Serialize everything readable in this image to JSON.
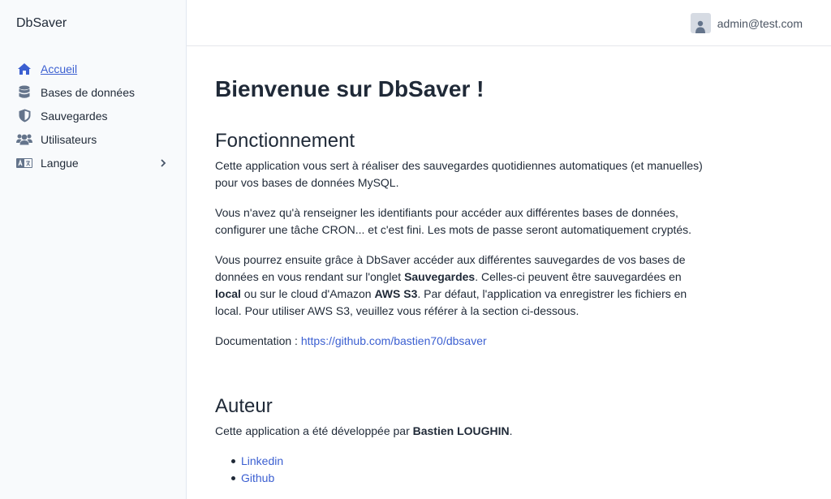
{
  "sidebar": {
    "brand": "DbSaver",
    "items": [
      {
        "label": "Accueil",
        "icon": "home-icon",
        "active": true
      },
      {
        "label": "Bases de données",
        "icon": "database-icon"
      },
      {
        "label": "Sauvegardes",
        "icon": "shield-icon"
      },
      {
        "label": "Utilisateurs",
        "icon": "users-icon"
      },
      {
        "label": "Langue",
        "icon": "language-icon",
        "has_submenu": true
      }
    ]
  },
  "header": {
    "user_email": "admin@test.com"
  },
  "main": {
    "title": "Bienvenue sur DbSaver !",
    "section1": {
      "heading": "Fonctionnement",
      "p1": "Cette application vous sert à réaliser des sauvegardes quotidiennes automatiques (et manuelles) pour vos bases de données MySQL.",
      "p2": "Vous n'avez qu'à renseigner les identifiants pour accéder aux différentes bases de données, configurer une tâche CRON... et c'est fini. Les mots de passe seront automatiquement cryptés.",
      "p3_a": "Vous pourrez ensuite grâce à DbSaver accéder aux différentes sauvegardes de vos bases de données en vous rendant sur l'onglet ",
      "p3_b": "Sauvegardes",
      "p3_c": ". Celles-ci peuvent être sauvegardées en ",
      "p3_d": "local",
      "p3_e": " ou sur le cloud d'Amazon ",
      "p3_f": "AWS S3",
      "p3_g": ". Par défaut, l'application va enregistrer les fichiers en local. Pour utiliser AWS S3, veuillez vous référer à la section ci-dessous.",
      "doc_label": "Documentation : ",
      "doc_link": "https://github.com/bastien70/dbsaver"
    },
    "section2": {
      "heading": "Auteur",
      "text": "Cette application a été développée par ",
      "author": "Bastien LOUGHIN",
      "text_end": ".",
      "links": [
        "Linkedin",
        "Github"
      ]
    }
  }
}
